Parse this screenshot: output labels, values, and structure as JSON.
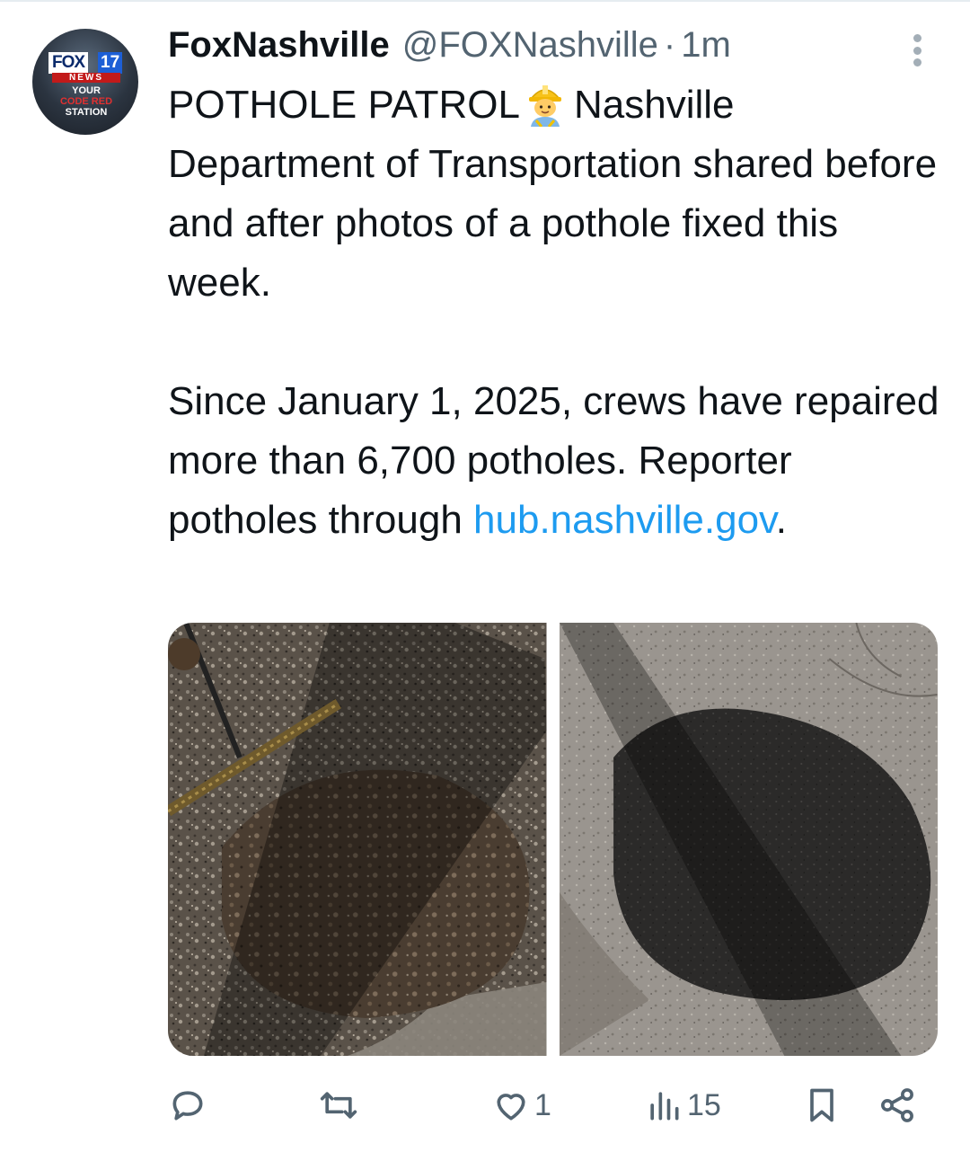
{
  "tweet": {
    "author": {
      "display_name": "FoxNashville",
      "handle": "@FOXNashville",
      "separator": "·",
      "time": "1m",
      "avatar": {
        "brand": "FOX",
        "channel": "17",
        "news": "NEWS",
        "tagline_1": "YOUR",
        "tagline_2": "CODE RED",
        "tagline_3": "STATION"
      }
    },
    "text": {
      "part_1": "POTHOLE PATROL",
      "emoji": "construction-worker",
      "part_2": "Nashville Department of Transportation shared before and after photos of a pothole fixed this week.",
      "paragraph_2": "Since January 1, 2025, crews have repaired more than 6,700 potholes. Reporter potholes through",
      "link": "hub.nashville.gov",
      "trailing": "."
    },
    "media": [
      {
        "icon": "pothole-before-photo"
      },
      {
        "icon": "pothole-after-photo"
      }
    ],
    "actions": {
      "reply": {
        "icon": "reply-icon",
        "count": ""
      },
      "retweet": {
        "icon": "retweet-icon",
        "count": ""
      },
      "like": {
        "icon": "heart-icon",
        "count": "1"
      },
      "views": {
        "icon": "views-icon",
        "count": "15"
      },
      "bookmark": {
        "icon": "bookmark-icon",
        "count": ""
      },
      "share": {
        "icon": "share-icon",
        "count": ""
      }
    }
  },
  "colors": {
    "link": "#1d9bf0",
    "secondary": "#536471",
    "primary_text": "#0f1419"
  }
}
